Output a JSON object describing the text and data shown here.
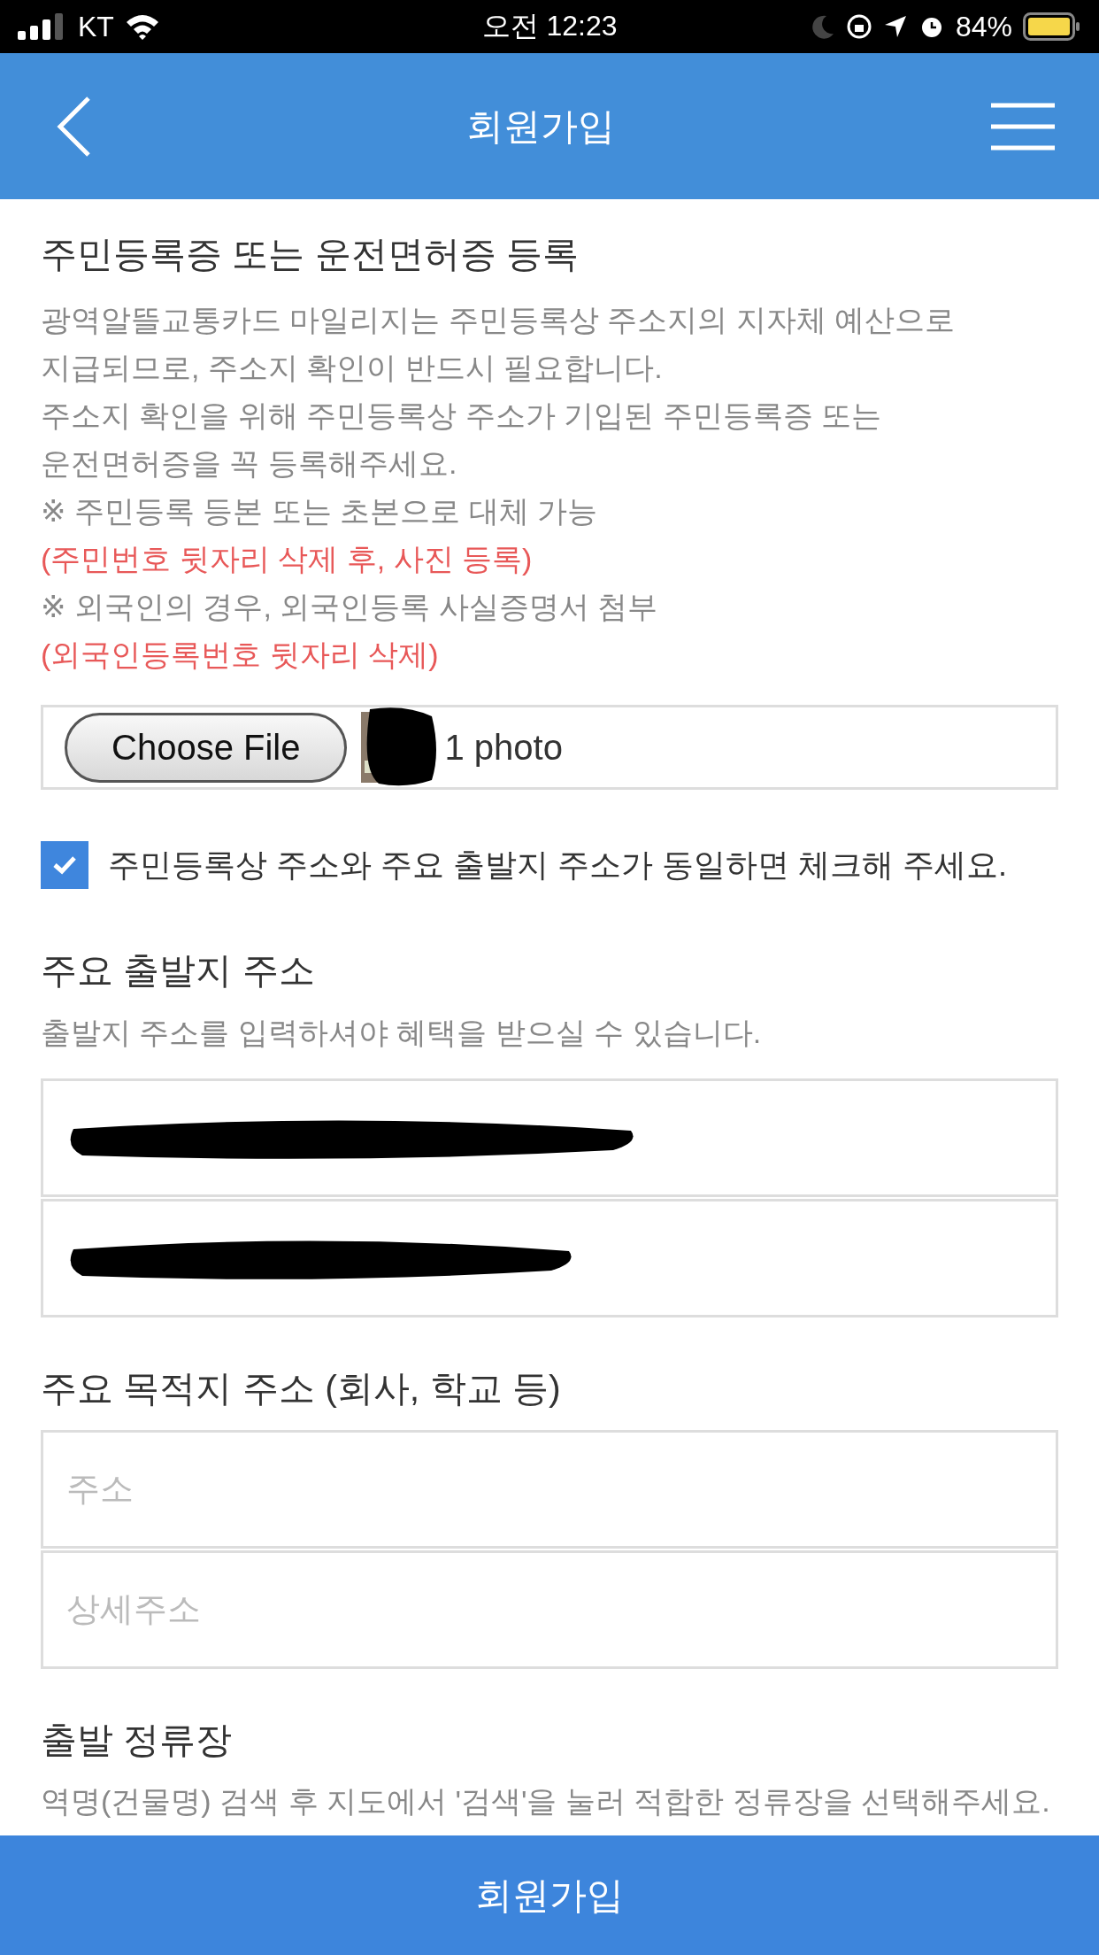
{
  "status_bar": {
    "carrier": "KT",
    "time": "오전 12:23",
    "battery": "84%"
  },
  "header": {
    "title": "회원가입"
  },
  "id_section": {
    "title": "주민등록증 또는 운전면허증 등록",
    "lines": [
      {
        "text": "광역알뜰교통카드 마일리지는 주민등록상 주소지의 지자체 예산으로",
        "kind": "note"
      },
      {
        "text": "지급되므로, 주소지 확인이 반드시 필요합니다.",
        "kind": "note"
      },
      {
        "text": "주소지 확인을 위해 주민등록상 주소가 기입된 주민등록증 또는",
        "kind": "note"
      },
      {
        "text": "운전면허증을 꼭 등록해주세요.",
        "kind": "note"
      },
      {
        "text": "※ 주민등록 등본 또는 초본으로 대체 가능",
        "kind": "note"
      },
      {
        "text": "(주민번호 뒷자리 삭제 후, 사진 등록)",
        "kind": "warning"
      },
      {
        "text": "※ 외국인의 경우, 외국인등록 사실증명서 첨부",
        "kind": "note"
      },
      {
        "text": "(외국인등록번호 뒷자리 삭제)",
        "kind": "warning"
      }
    ],
    "file": {
      "button": "Choose File",
      "summary": "1 photo"
    }
  },
  "same_address": {
    "label": "주민등록상 주소와 주요 출발지 주소가 동일하면 체크해 주세요.",
    "checked": true
  },
  "origin_section": {
    "title": "주요 출발지 주소",
    "hint": "출발지 주소를 입력하셔야 혜택을 받으실 수 있습니다.",
    "fields": [
      {
        "redacted": true
      },
      {
        "redacted": true
      }
    ]
  },
  "destination_section": {
    "title": "주요 목적지 주소 (회사, 학교 등)",
    "fields": [
      {
        "placeholder": "주소"
      },
      {
        "placeholder": "상세주소"
      }
    ]
  },
  "stop_section": {
    "title": "출발 정류장",
    "hint": "역명(건물명) 검색 후 지도에서 '검색'을 눌러 적합한 정류장을 선택해주세요."
  },
  "submit": {
    "label": "회원가입"
  }
}
